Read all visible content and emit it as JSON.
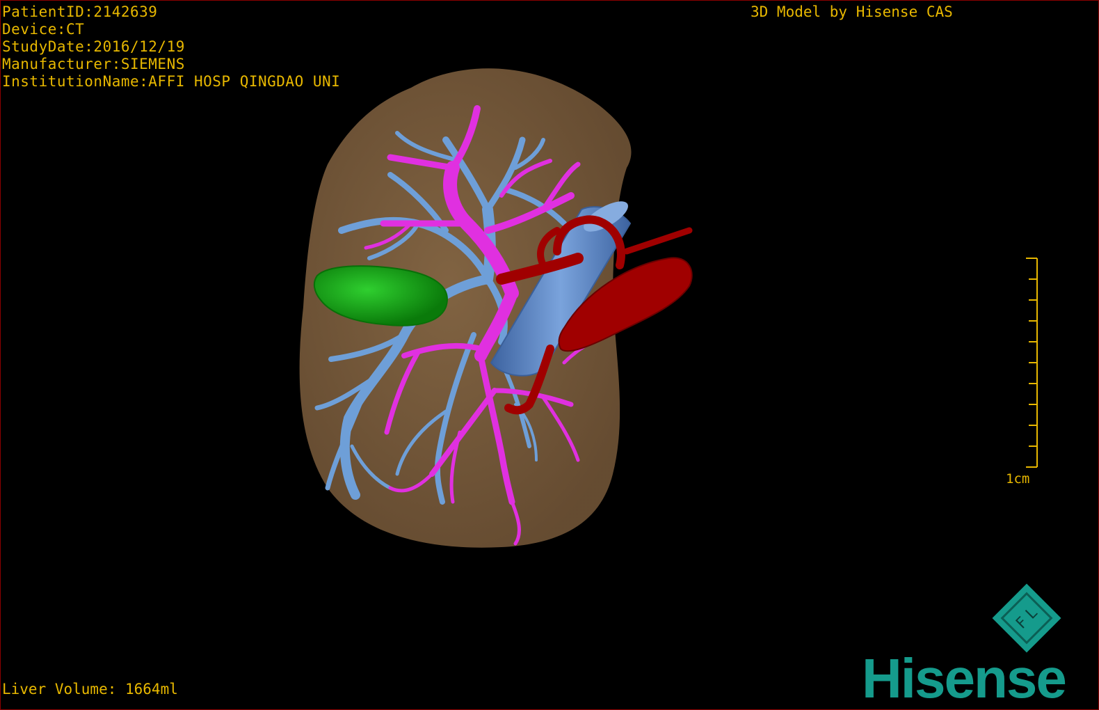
{
  "header": {
    "patient_id": "PatientID:2142639",
    "device": "Device:CT",
    "study_date": "StudyDate:2016/12/19",
    "manufacturer": "Manufacturer:SIEMENS",
    "institution": "InstitutionName:AFFI HOSP QINGDAO UNI"
  },
  "credit": "3D Model by Hisense CAS",
  "footer": {
    "liver_volume": "Liver Volume: 1664ml"
  },
  "scale_bar": {
    "label": "1cm"
  },
  "logo": {
    "brand": "Hisense",
    "mark_text": "F L"
  },
  "colors": {
    "text": "#e8b800",
    "liver": "#8a6a45",
    "portal_vein": "#e030e0",
    "hepatic_vein": "#6e9fd8",
    "ivc": "#5b85c0",
    "artery": "#a00000",
    "lesion": "#10a010",
    "brand": "#159b8c"
  }
}
